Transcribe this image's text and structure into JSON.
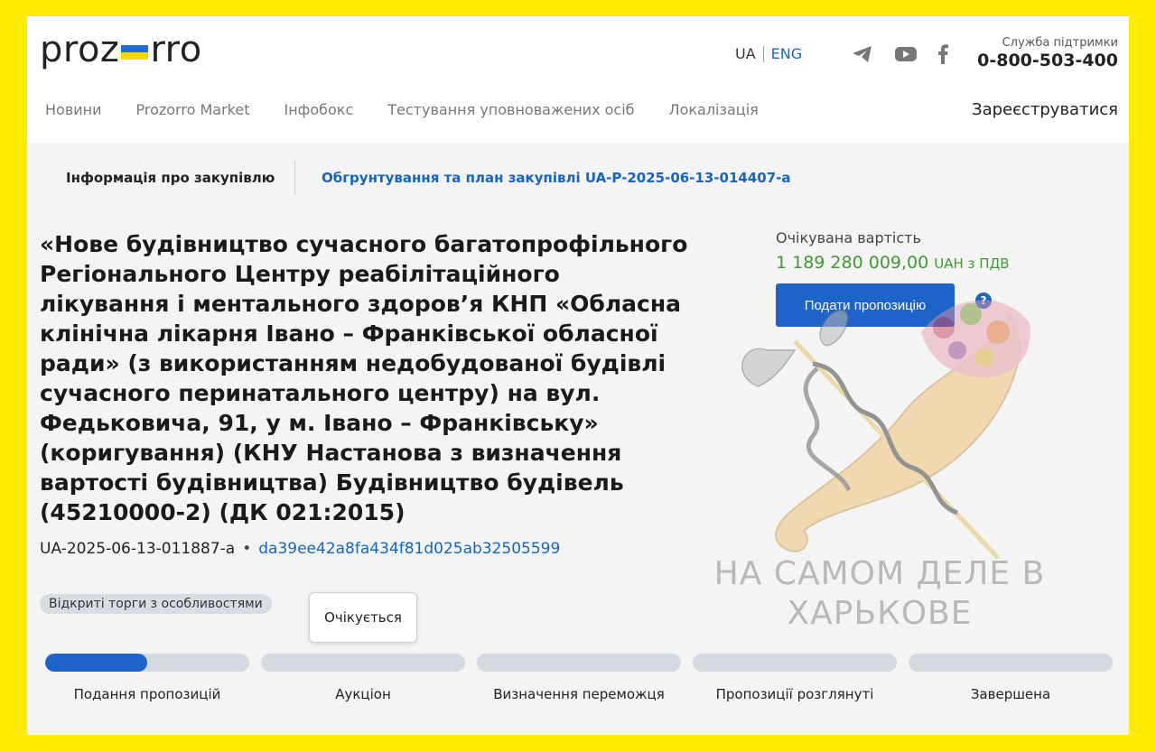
{
  "header": {
    "logo_left": "proz",
    "logo_right": "rro",
    "lang_ua": "UA",
    "lang_eng": "ENG",
    "support_label": "Служба підтримки",
    "support_phone": "0-800-503-400",
    "register": "Зареєструватися"
  },
  "nav": {
    "items": [
      "Новини",
      "Prozorro Market",
      "Інфобокс",
      "Тестування уповноважених осіб",
      "Локалізація"
    ]
  },
  "tabs": {
    "info": "Інформація про закупівлю",
    "plan": "Обгрунтування та план закупівлі UA-P-2025-06-13-014407-a"
  },
  "tender": {
    "title": "«Нове будівництво сучасного багатопрофільного Регіонального Центру реабілітаційного лікування і ментального здоров’я КНП «Обласна клінічна лікарня Івано – Франківської обласної ради» (з використанням недобудованої будівлі сучасного перинатального центру) на вул. Федьковича, 91, у м. Івано – Франківську» (коригування) (КНУ Настанова з визначення вартості будівництва) Будівництво будівель (45210000-2) (ДК 021:2015)",
    "id": "UA-2025-06-13-011887-a",
    "dot": "•",
    "hash": "da39ee42a8fa434f81d025ab32505599",
    "type_badge": "Відкриті торги з особливостями",
    "status_badge": "Очікується"
  },
  "price": {
    "label": "Очікувана вартість",
    "value": "1 189 280 009,00",
    "currency": "UAH з ПДВ",
    "submit": "Подати пропозицію",
    "help": "?"
  },
  "watermark": {
    "line1": "НА САМОМ ДЕЛЕ В",
    "line2": "ХАРЬКОВЕ"
  },
  "stages": [
    {
      "label": "Подання пропозицій",
      "progress": 0.5
    },
    {
      "label": "Аукціон",
      "progress": 0
    },
    {
      "label": "Визначення переможця",
      "progress": 0
    },
    {
      "label": "Пропозиції розглянуті",
      "progress": 0
    },
    {
      "label": "Завершена",
      "progress": 0
    }
  ],
  "colors": {
    "frame": "#ffeb00",
    "accent_blue": "#1e63c8",
    "link_blue": "#1565c0",
    "price_green": "#3f9a2f"
  },
  "icons": [
    "telegram-icon",
    "youtube-icon",
    "facebook-icon",
    "help-icon"
  ]
}
